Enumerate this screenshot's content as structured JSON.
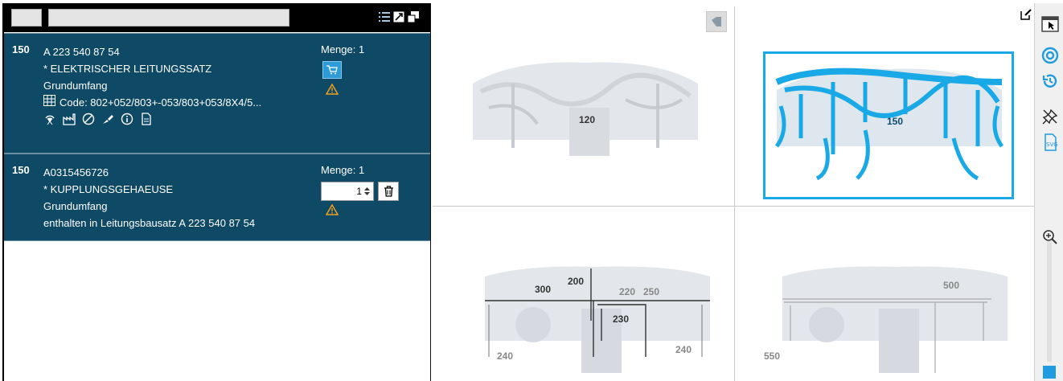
{
  "list": {
    "rows": [
      {
        "pos": "150",
        "number": "A 223 540 87 54",
        "name": "* ELEKTRISCHER LEITUNGSSATZ",
        "scope": "Grundumfang",
        "code": "Code: 802+052/803+-053/803+053/8X4/5...",
        "menge": "Menge: 1"
      },
      {
        "pos": "150",
        "number": "A0315456726",
        "name": "* KUPPLUNGSGEHAEUSE",
        "scope": "Grundumfang",
        "info": "enthalten in Leitungsbausatz A 223 540 87 54",
        "menge": "Menge: 1",
        "qty_value": "1"
      }
    ]
  },
  "viewer": {
    "labels": {
      "tl": "120",
      "tr": "150",
      "bl_200": "200",
      "bl_300": "300",
      "bl_220": "220",
      "bl_250": "250",
      "bl_230": "230",
      "bl_240a": "240",
      "bl_240b": "240",
      "br_500": "500",
      "br_550": "550"
    }
  },
  "colors": {
    "row_bg": "#0e4965",
    "accent": "#19a9e6",
    "warning": "#f0a020"
  }
}
